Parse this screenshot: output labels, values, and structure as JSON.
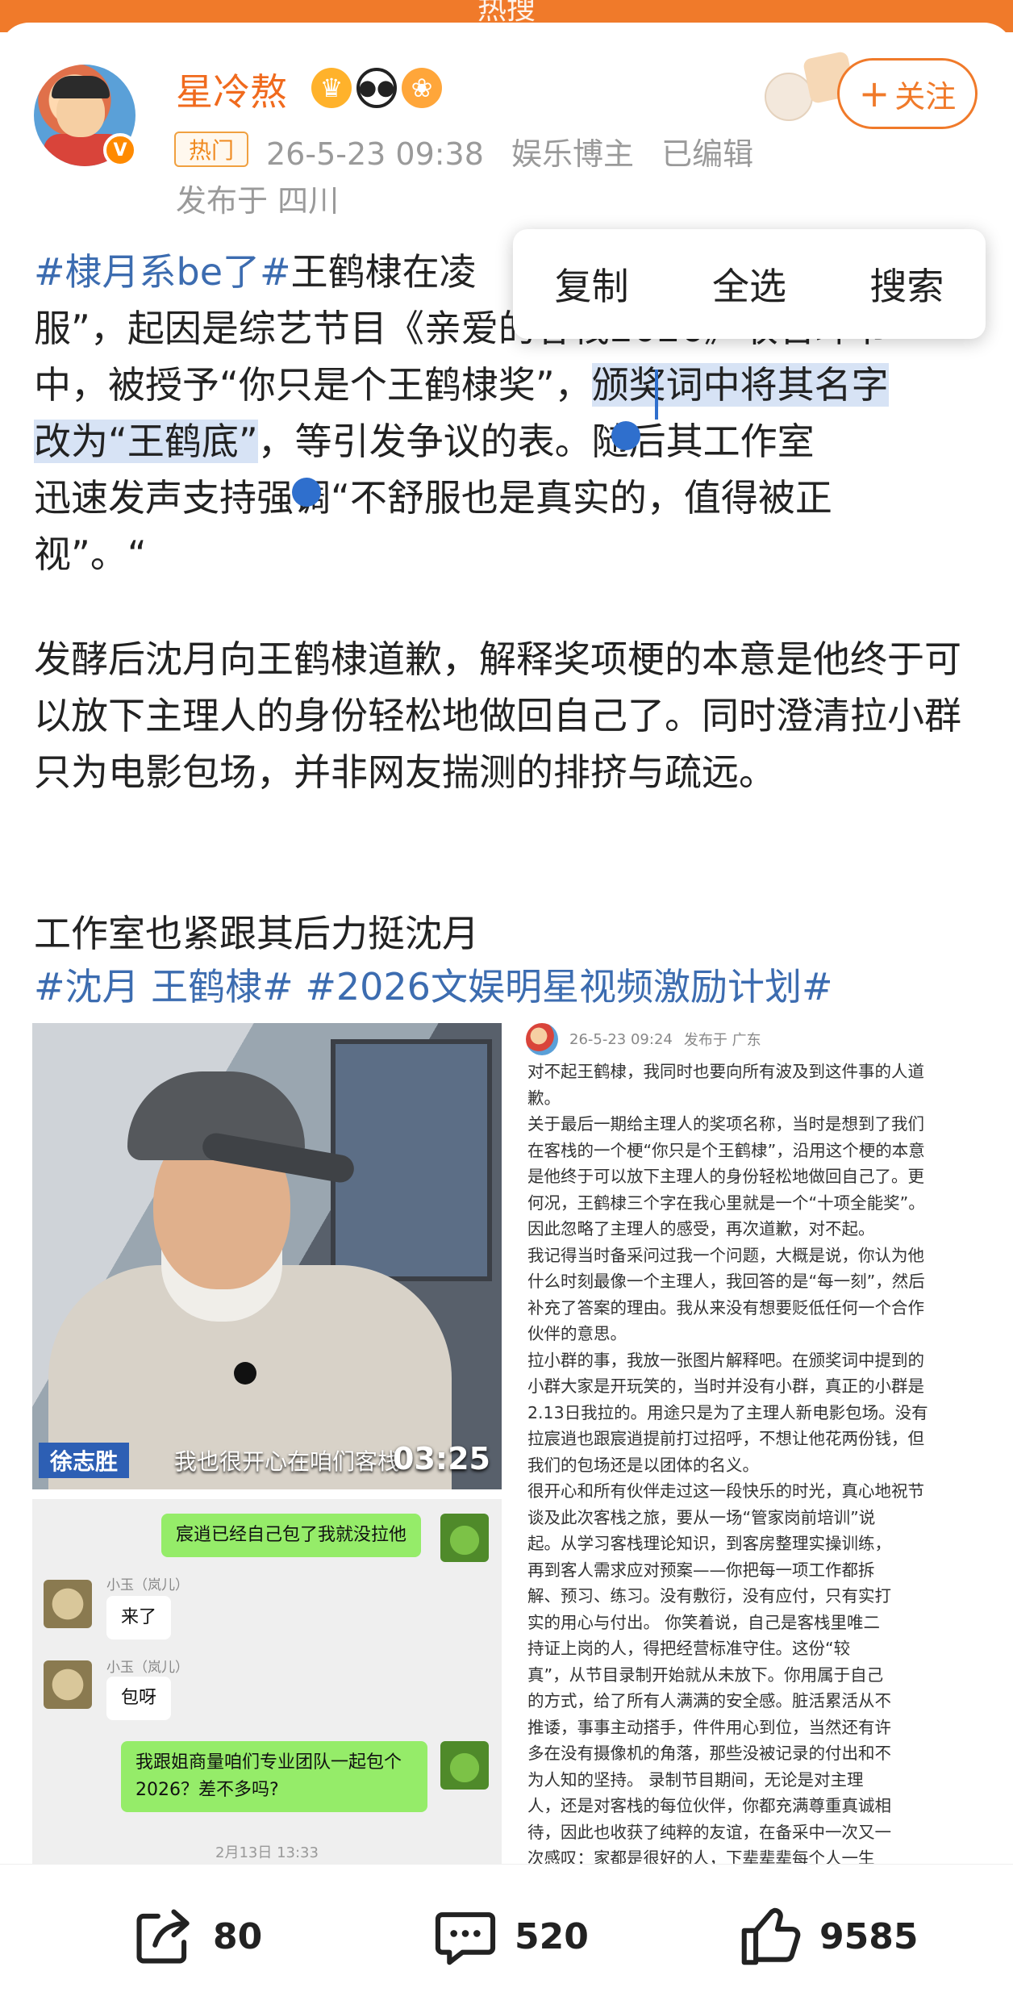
{
  "status_bar": {
    "partial_title": "热搜"
  },
  "author": {
    "name": "星冷熬",
    "hot_badge": "热门",
    "date": "26-5-23 09:38",
    "category": "娱乐博主",
    "edited": "已编辑",
    "location": "发布于 四川",
    "follow_label": "关注",
    "follow_plus": "+"
  },
  "context_menu": {
    "copy": "复制",
    "select_all": "全选",
    "search": "搜索"
  },
  "post": {
    "tag1": "#棣月系be了#",
    "p1_a": "王鹤棣在凌",
    "p1_b": "服”，起因是综艺节目《亲爱的客栈2026》",
    "p1_b2": "收官环节",
    "p1_c": "中，被授予“你只是个王鹤棣奖”，",
    "p1_hl1": "颁奖词中将其名字",
    "p1_hl2": "改为“王鹤底”",
    "p1_d": "，等引发争议的表",
    "p1_d2": "。随后其工作室",
    "p1_e": "迅速发声支持",
    "p1_e2": "强调“不舒服也是真实的，值得被正",
    "p1_f": "视”。“",
    "p2": "发酵后沈月向王鹤棣道歉，解释奖项梗的本意是他终于可以放下主理人的身份轻松地做回自己了。同时澄清拉小群只为电影包场，并非网友揣测的排挤与疏远。",
    "p3": "工作室也紧跟其后力挺沈月",
    "tag2": "#沈月 王鹤棣#",
    "tag3": "#2026文娱明星视频激励计划#"
  },
  "video": {
    "name_tag": "徐志胜",
    "caption": "我也很开心在咱们客栈",
    "duration": "03:25"
  },
  "chat": {
    "msg1": "宸逍已经自己包了我就没拉他",
    "name1": "小玉（岚儿）",
    "msg2": "来了",
    "name2": "小玉（岚儿）",
    "msg3": "包呀",
    "msg4": "我跟姐商量咱们专业团队一起包个2026？差不多吗?",
    "time": "2月13日 13:33"
  },
  "doc": {
    "date": "26-5-23 09:24",
    "location": "发布于 广东",
    "lines": [
      "对不起王鹤棣，我同时也要向所有波及到这件事的人道",
      "歉。",
      "关于最后一期给主理人的奖项名称，当时是想到了我们",
      "在客栈的一个梗“你只是个王鹤棣”，沿用这个梗的本意",
      "是他终于可以放下主理人的身份轻松地做回自己了。更",
      "何况，王鹤棣三个字在我心里就是一个“十项全能奖”。",
      "因此忽略了主理人的感受，再次道歉，对不起。",
      "我记得当时备采问过我一个问题，大概是说，你认为他",
      "什么时刻最像一个主理人，我回答的是“每一刻”，然后",
      "补充了答案的理由。我从来没有想要贬低任何一个合作",
      "伙伴的意思。",
      "拉小群的事，我放一张图片解释吧。在颁奖词中提到的",
      "小群大家是开玩笑的，当时并没有小群，真正的小群是",
      "2.13日我拉的。用途只是为了主理人新电影包场。没有",
      "拉宸逍也跟宸逍提前打过招呼，不想让他花两份钱，但",
      "我们的包场还是以团体的名义。",
      "很开心和所有伙伴走过这一段快乐的时光，真心地祝节",
      "谈及此次客栈之旅，要从一场“管家岗前培训”说",
      "起。从学习客栈理论知识，到客房整理实操训练，",
      "再到客人需求应对预案——你把每一项工作都拆",
      "解、预习、练习。没有敷衍，没有应付，只有实打",
      "实的用心与付出。 你笑着说，自己是客栈里唯二",
      "持证上岗的人，得把经营标准守住。这份“较",
      "真”，从节目录制开始就从未放下。你用属于自己",
      "的方式，给了所有人满满的安全感。脏活累活从不",
      "推诿，事事主动搭手，件件用心到位，当然还有许",
      "多在没有摄像机的角落，那些没被记录的付出和不",
      "为人知的坚持。 录制节目期间，无论是对主理",
      "人，还是对客栈的每位伙伴，你都充满尊重真诚相",
      "待，因此也收获了纯粹的友谊，在备采中一次又一",
      "次感叹：家都是很好的人，下辈辈辈每个人一生"
    ]
  },
  "actions": {
    "share_count": "80",
    "comment_count": "520",
    "like_count": "9585"
  },
  "colors": {
    "accent": "#f07a2a",
    "hashtag": "#3c6cb0",
    "highlight": "#d7e3f5",
    "selection": "#2f6fcd"
  }
}
